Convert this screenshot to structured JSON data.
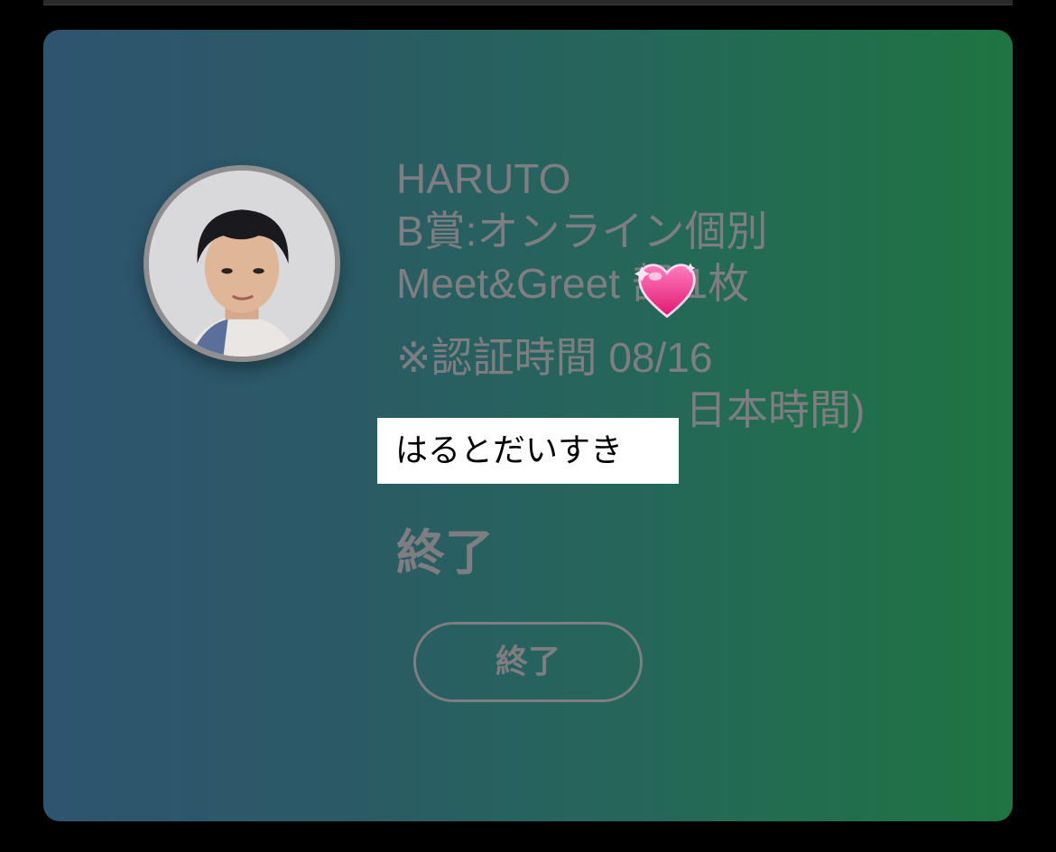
{
  "card": {
    "artist": "HARUTO",
    "prize_line": "B賞:オンライン個別",
    "event_line": "Meet&Greet 部 1枚",
    "auth_time_line": "※認証時間 08/16",
    "timezone_tail": "日本時間)",
    "status": "終了",
    "button_label": "終了"
  },
  "overlay": {
    "sticker_text": "はるとだいすき",
    "heart": "sparkling-heart-emoji"
  },
  "colors": {
    "gradient_left": "#2e5470",
    "gradient_right": "#1f7442",
    "muted_text": "#7e7e82"
  }
}
